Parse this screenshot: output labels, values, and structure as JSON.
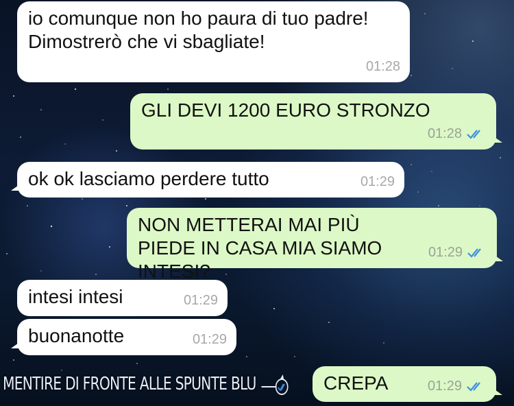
{
  "messages": [
    {
      "direction": "in",
      "text": "io comunque non ho paura di tuo padre! Dimostrerò che vi sbagliate!",
      "time": "01:28"
    },
    {
      "direction": "out",
      "text": "GLI DEVI 1200 EURO STRONZO",
      "time": "01:28",
      "status": "read"
    },
    {
      "direction": "in",
      "text": "ok ok lasciamo perdere tutto",
      "time": "01:29"
    },
    {
      "direction": "out",
      "text": "NON METTERAI MAI PIÙ PIEDE IN CASA MIA SIAMO INTESI?",
      "time": "01:29",
      "status": "read"
    },
    {
      "direction": "in",
      "text": "intesi intesi",
      "time": "01:29"
    },
    {
      "direction": "in",
      "text": "buonanotte",
      "time": "01:29"
    },
    {
      "direction": "out",
      "text": "CREPA",
      "time": "01:29",
      "status": "read"
    }
  ],
  "watermark": {
    "text": "MENTIRE DI FRONTE ALLE SPUNTE BLU",
    "icon": "double-check-logo-icon"
  },
  "colors": {
    "incoming_bubble": "#ffffff",
    "outgoing_bubble": "#dcf8c6",
    "read_ticks": "#3d8fe0",
    "timestamp": "#9aa39a"
  }
}
